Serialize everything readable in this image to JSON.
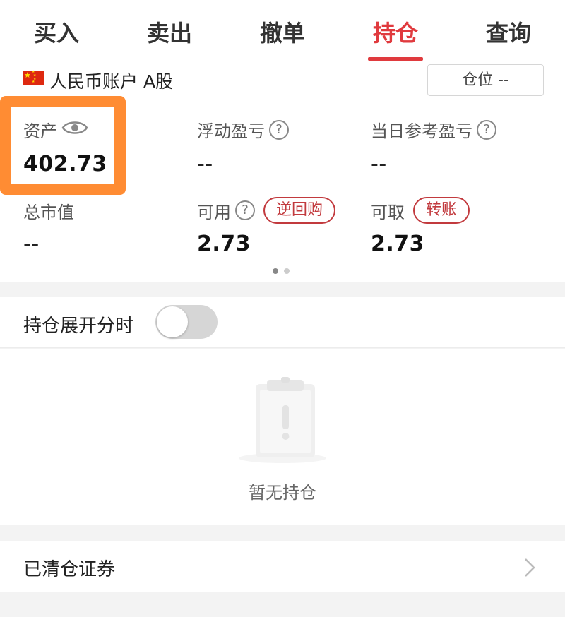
{
  "tabs": [
    {
      "label": "买入",
      "active": false
    },
    {
      "label": "卖出",
      "active": false
    },
    {
      "label": "撤单",
      "active": false
    },
    {
      "label": "持仓",
      "active": true
    },
    {
      "label": "查询",
      "active": false
    }
  ],
  "account": {
    "name": "人民币账户 A股",
    "position_button": "仓位 --"
  },
  "summary": {
    "assets_label": "资产",
    "assets_value": "402.73",
    "floating_pl_label": "浮动盈亏",
    "floating_pl_value": "--",
    "daily_pl_label": "当日参考盈亏",
    "daily_pl_value": "--",
    "market_value_label": "总市值",
    "market_value_value": "--",
    "available_label": "可用",
    "available_value": "2.73",
    "reverse_repo_button": "逆回购",
    "withdrawable_label": "可取",
    "withdrawable_value": "2.73",
    "transfer_button": "转账",
    "help_glyph": "?"
  },
  "holdings_toggle": {
    "label": "持仓展开分时",
    "on": false
  },
  "empty_state": {
    "text": "暂无持仓"
  },
  "cleared": {
    "label": "已清仓证券"
  },
  "colors": {
    "accent": "#e03a3e",
    "highlight": "#ff8c33"
  }
}
